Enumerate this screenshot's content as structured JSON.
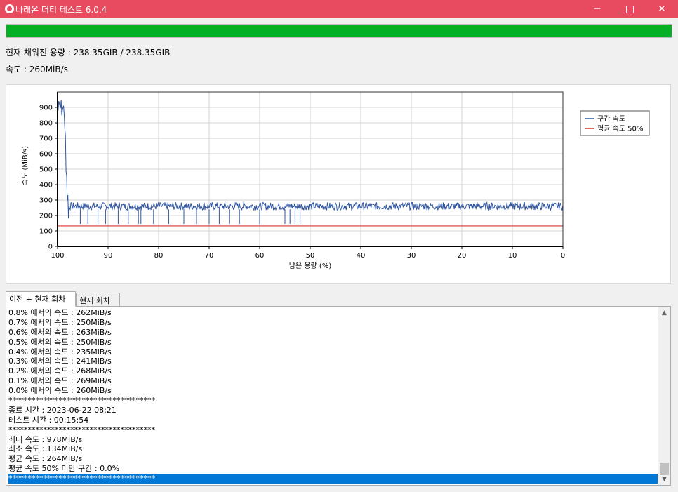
{
  "window": {
    "title": "나래온 더티 테스트 6.0.4"
  },
  "progress": {
    "percent": 100
  },
  "status": {
    "filled": "현재 채워진 용량 : 238.35GIB / 238.35GIB",
    "speed": "속도 : 260MiB/s"
  },
  "chart_data": {
    "type": "line",
    "xlabel": "남은 용량 (%)",
    "ylabel": "속도 (MiB/s)",
    "xlim": [
      100,
      0
    ],
    "ylim": [
      0,
      1000
    ],
    "xticks": [
      "100",
      "90",
      "80",
      "70",
      "60",
      "50",
      "40",
      "30",
      "20",
      "10",
      "0"
    ],
    "yticks": [
      "0",
      "100",
      "200",
      "300",
      "400",
      "500",
      "600",
      "700",
      "800",
      "900"
    ],
    "grid": true,
    "legend_position": "top-right",
    "series": [
      {
        "name": "구간 속도",
        "color": "#2f55a0",
        "x": [
          100,
          99.4,
          98.6,
          98.3,
          97.8,
          95,
          90,
          80,
          70,
          60,
          50,
          40,
          30,
          20,
          10,
          1,
          0.3,
          0.1
        ],
        "y": [
          950,
          960,
          940,
          560,
          270,
          268,
          265,
          262,
          263,
          262,
          264,
          262,
          263,
          262,
          263,
          262,
          268,
          260
        ]
      },
      {
        "name": "평균 속도 50%",
        "color": "#e03030",
        "x": [
          100,
          0
        ],
        "y": [
          132,
          132
        ]
      }
    ],
    "annotations": {
      "noise_band": [
        235,
        285
      ],
      "dip_positions": [
        95.5,
        94,
        92,
        90.5,
        88,
        86,
        84,
        83.5,
        81,
        78,
        75,
        72.5,
        70,
        68,
        66,
        64,
        60,
        55,
        54,
        53,
        52
      ],
      "dip_value": 145
    }
  },
  "tabs": [
    {
      "label": "이전 + 현재 회차",
      "active": true
    },
    {
      "label": "현재 회차",
      "active": false
    }
  ],
  "log": [
    "0.8% 에서의 속도 : 262MiB/s",
    "0.7% 에서의 속도 : 250MiB/s",
    "0.6% 에서의 속도 : 263MiB/s",
    "0.5% 에서의 속도 : 250MiB/s",
    "0.4% 에서의 속도 : 235MiB/s",
    "0.3% 에서의 속도 : 241MiB/s",
    "0.2% 에서의 속도 : 268MiB/s",
    "0.1% 에서의 속도 : 269MiB/s",
    "0.0% 에서의 속도 : 260MiB/s",
    "**************************************",
    "종료 시간 : 2023-06-22 08:21",
    "테스트 시간 : 00:15:54",
    "**************************************",
    "최대 속도 : 978MiB/s",
    "최소 속도 : 134MiB/s",
    "평균 속도 : 264MiB/s",
    "평균 속도 50% 미만 구간 : 0.0%",
    "**************************************"
  ],
  "selected_log_index": 17,
  "icons": {
    "app": "app-logo-icon",
    "minimize": "minimize-icon",
    "maximize": "maximize-icon",
    "close": "close-icon",
    "scroll_up": "chevron-up-icon",
    "scroll_down": "chevron-down-icon"
  }
}
